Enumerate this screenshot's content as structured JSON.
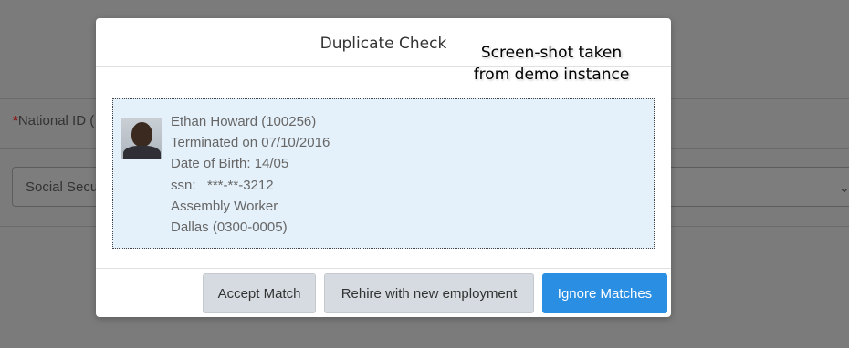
{
  "background_form": {
    "required_marker": "*",
    "national_id_label": "National ID (",
    "id_type_value": "Social Secu"
  },
  "dialog": {
    "title": "Duplicate Check",
    "watermark": [
      "Screen-shot taken",
      "from demo instance"
    ],
    "match": {
      "name": "Ethan Howard (100256)",
      "status": "Terminated on 07/10/2016",
      "dob": "Date of Birth: 14/05",
      "ssn": "ssn:   ***-**-3212",
      "job": "Assembly Worker",
      "location": "Dallas (0300-0005)"
    },
    "buttons": {
      "accept": "Accept Match",
      "rehire": "Rehire with new employment",
      "ignore": "Ignore Matches"
    }
  },
  "colors": {
    "primary_button": "#2a8ee3",
    "match_card_bg": "#e5f1fa",
    "required_marker": "#8b1010"
  }
}
